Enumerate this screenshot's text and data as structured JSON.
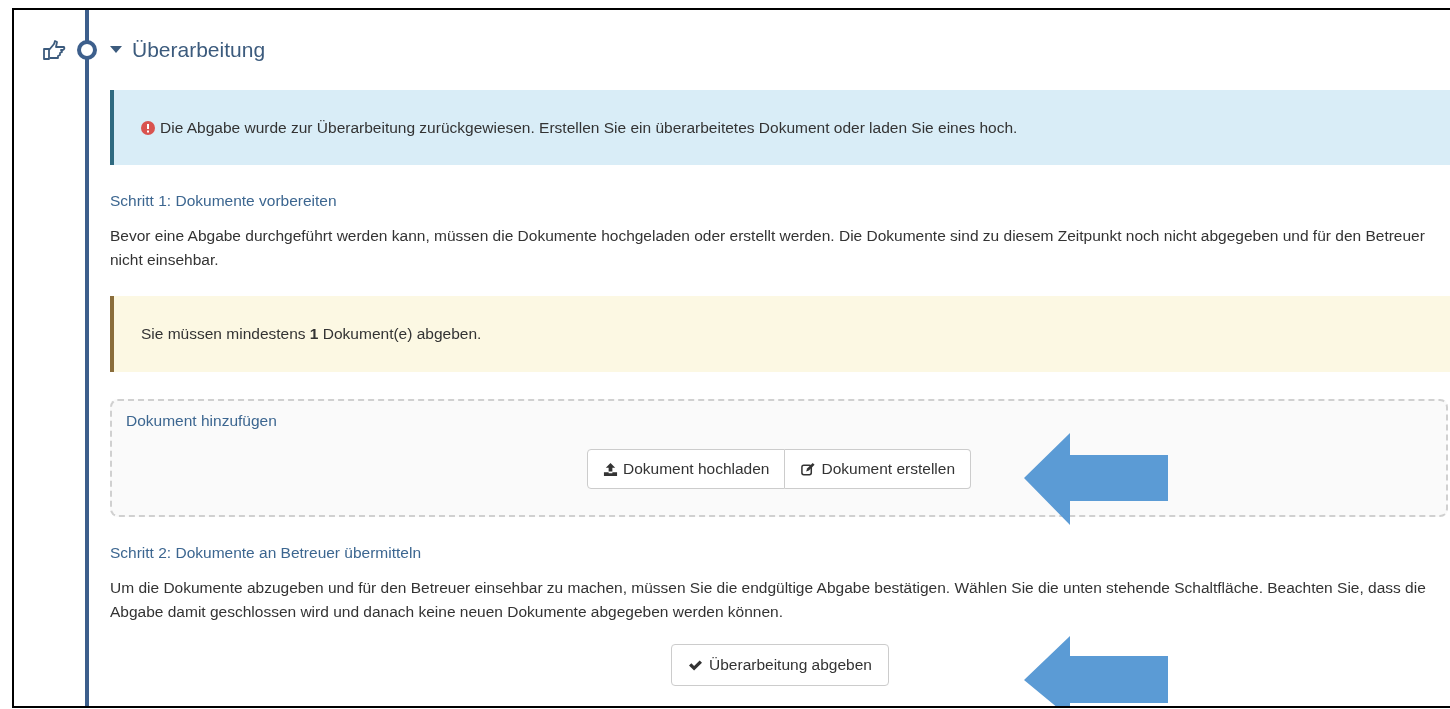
{
  "step": {
    "title": "Überarbeitung",
    "expanded": true
  },
  "alert": {
    "text": "Die Abgabe wurde zur Überarbeitung zurückgewiesen. Erstellen Sie ein überarbeitetes Dokument oder laden Sie eines hoch."
  },
  "sections": [
    {
      "heading": "Schritt 1: Dokumente vorbereiten",
      "text": "Bevor eine Abgabe durchgeführt werden kann, müssen die Dokumente hochgeladen oder erstellt werden. Die Dokumente sind zu diesem Zeitpunkt noch nicht abgegeben und für den Betreuer nicht einsehbar.",
      "notice": "Sie müssen mindestens **1** Dokument(e) abgeben.",
      "dropzone": {
        "heading": "Dokument hinzufügen",
        "buttons": [
          {
            "label": "Dokument hochladen",
            "kind": "upload"
          },
          {
            "label": "Dokument erstellen",
            "kind": "edit"
          }
        ]
      }
    },
    {
      "heading": "Schritt 2: Dokumente an Betreuer übermitteln",
      "text": "Um die Dokumente abzugeben und für den Betreuer einsehbar zu machen, müssen Sie die endgültige Abgabe bestätigen. Wählen Sie die unten stehende Schaltfläche. Beachten Sie, dass die Abgabe damit geschlossen wird und danach keine neuen Dokumente abgegeben werden können.",
      "submit": {
        "label": "Überarbeitung abgeben",
        "kind": "check"
      }
    }
  ]
}
